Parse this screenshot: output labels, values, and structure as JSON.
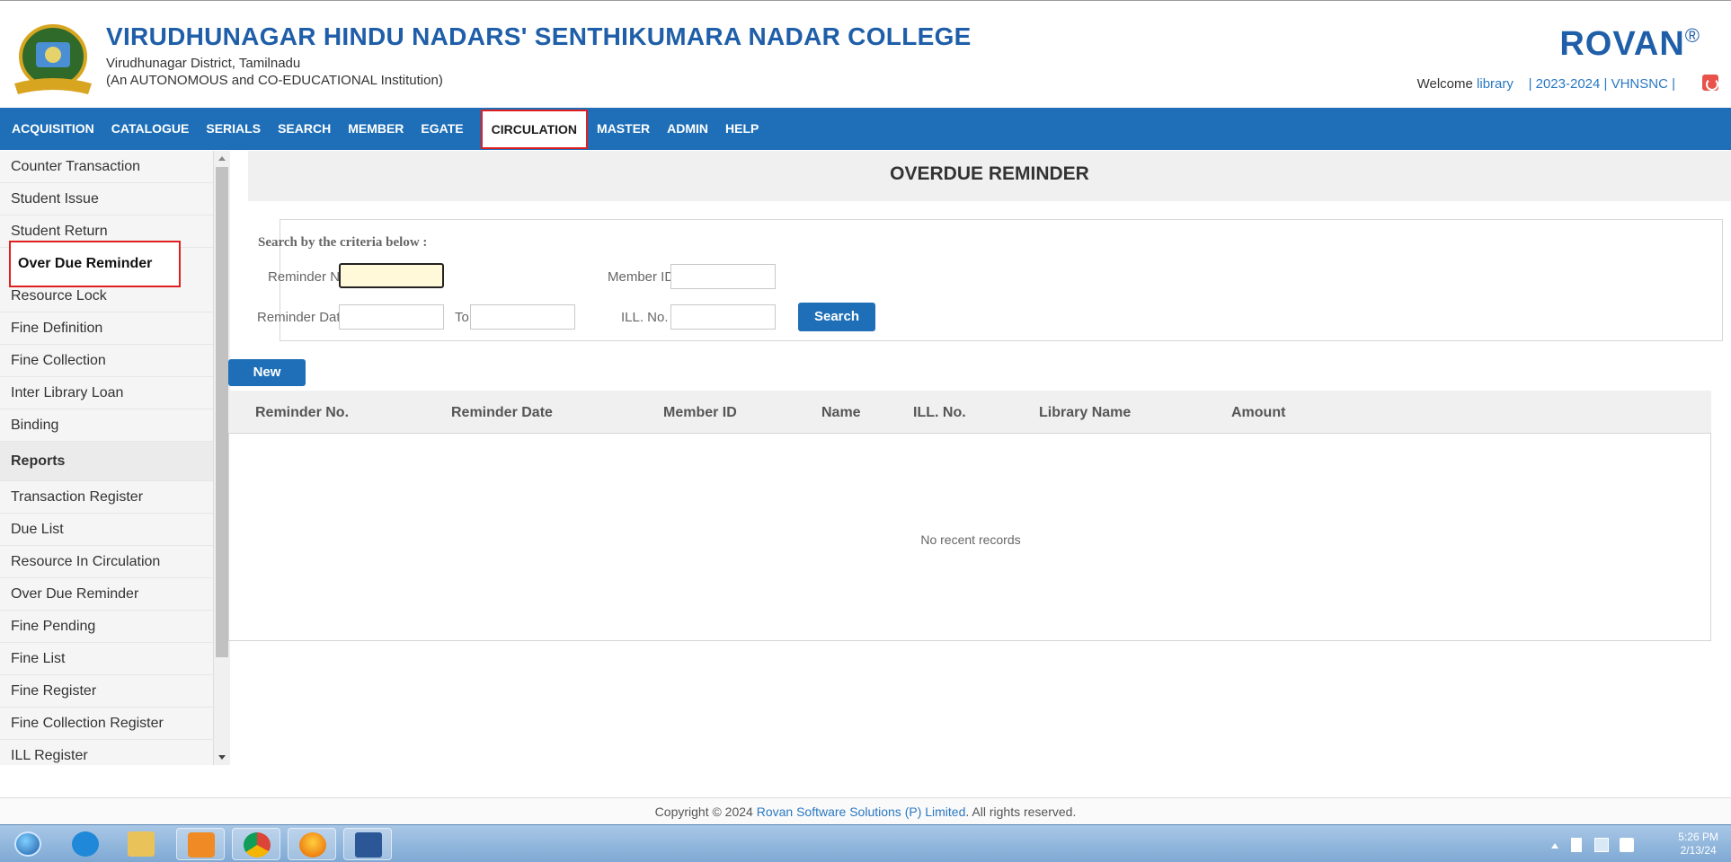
{
  "header": {
    "college_name": "VIRUDHUNAGAR HINDU NADARS' SENTHIKUMARA NADAR COLLEGE",
    "district": "Virudhunagar District, Tamilnadu",
    "status": "(An AUTONOMOUS and CO-EDUCATIONAL Institution)",
    "brand": "ROVAN",
    "brand_mark": "®",
    "welcome_label": "Welcome",
    "username": "library",
    "year": "| 2023-2024 | VHNSNC |",
    "colors": {
      "primary_blue": "#1e6fb8",
      "title_blue": "#1f5ea8",
      "highlight_red": "#e02020"
    }
  },
  "nav": {
    "items": [
      {
        "label": "ACQUISITION"
      },
      {
        "label": "CATALOGUE"
      },
      {
        "label": "SERIALS"
      },
      {
        "label": "SEARCH"
      },
      {
        "label": "MEMBER"
      },
      {
        "label": "EGATE"
      },
      {
        "label": "CIRCULATION",
        "active": true
      },
      {
        "label": "MASTER"
      },
      {
        "label": "ADMIN"
      },
      {
        "label": "HELP"
      }
    ]
  },
  "sidebar": {
    "items": [
      {
        "label": "Counter Transaction"
      },
      {
        "label": "Student Issue"
      },
      {
        "label": "Student Return"
      },
      {
        "label": "Over Due Reminder",
        "selected": true
      },
      {
        "label": "Resource Lock"
      },
      {
        "label": "Fine Definition"
      },
      {
        "label": "Fine Collection"
      },
      {
        "label": "Inter Library Loan"
      },
      {
        "label": "Binding"
      },
      {
        "label": "Reports",
        "section": true
      },
      {
        "label": "Transaction Register"
      },
      {
        "label": "Due List"
      },
      {
        "label": "Resource In Circulation"
      },
      {
        "label": "Over Due Reminder"
      },
      {
        "label": "Fine Pending"
      },
      {
        "label": "Fine List"
      },
      {
        "label": "Fine Register"
      },
      {
        "label": "Fine Collection Register"
      },
      {
        "label": "ILL Register"
      }
    ]
  },
  "main": {
    "title": "OVERDUE REMINDER",
    "criteria_title": "Search by the criteria below :",
    "labels": {
      "reminder_no": "Reminder No.",
      "member_id": "Member ID.",
      "reminder_date": "Reminder Date",
      "to": "To",
      "ill_no": "ILL. No."
    },
    "values": {
      "reminder_no": "",
      "member_id": "",
      "date_from": "",
      "date_to": "",
      "ill_no": ""
    },
    "search_button": "Search",
    "new_button": "New",
    "columns": [
      "Reminder No.",
      "Reminder Date",
      "Member ID",
      "Name",
      "ILL. No.",
      "Library Name",
      "Amount"
    ],
    "empty_text": "No recent records"
  },
  "footer": {
    "prefix": "Copyright © 2024 ",
    "company": "Rovan Software Solutions (P) Limited",
    "suffix": ". All rights reserved."
  },
  "taskbar": {
    "apps": [
      "start-orb-icon",
      "ie-icon",
      "file-explorer-icon",
      "media-player-icon",
      "chrome-icon",
      "firefox-icon",
      "word-icon"
    ],
    "time": "5:26 PM",
    "date": "2/13/24"
  }
}
